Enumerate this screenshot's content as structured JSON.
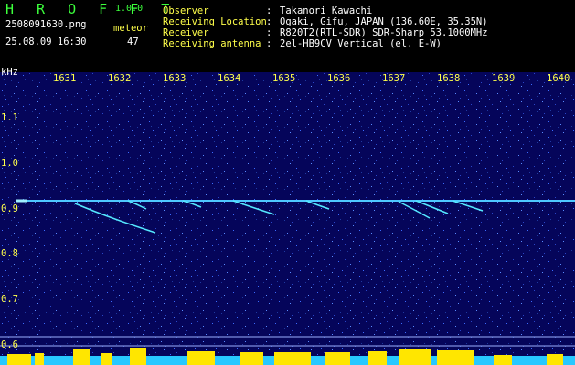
{
  "app": {
    "title": "H R O F F T",
    "version": "1.0.0"
  },
  "file": {
    "name": "2508091630.png",
    "datetime": "25.08.09 16:30"
  },
  "meteor": {
    "label": "meteor",
    "count": "47"
  },
  "info": [
    {
      "label": "Observer",
      "value": "Takanori Kawachi"
    },
    {
      "label": "Receiving Location",
      "value": "Ogaki, Gifu, JAPAN (136.60E, 35.35N)"
    },
    {
      "label": "Receiver",
      "value": "R820T2(RTL-SDR) SDR-Sharp 53.1000MHz"
    },
    {
      "label": "Receiving antenna",
      "value": "2el-HB9CV Vertical (el. E-W)"
    }
  ],
  "axis": {
    "unit": "kHz",
    "x_ticks": [
      "1631",
      "1632",
      "1633",
      "1634",
      "1635",
      "1636",
      "1637",
      "1638",
      "1639",
      "1640"
    ],
    "y_ticks": [
      "1.1",
      "1.0",
      "0.9",
      "0.8",
      "0.7",
      "0.6"
    ]
  },
  "colors": {
    "title": "#3cff3c",
    "label": "#ffff4a",
    "background": "#05055a",
    "carrier": "#4ec8ff",
    "bars": "#ffe600",
    "baseline": "#27c8ff"
  }
}
